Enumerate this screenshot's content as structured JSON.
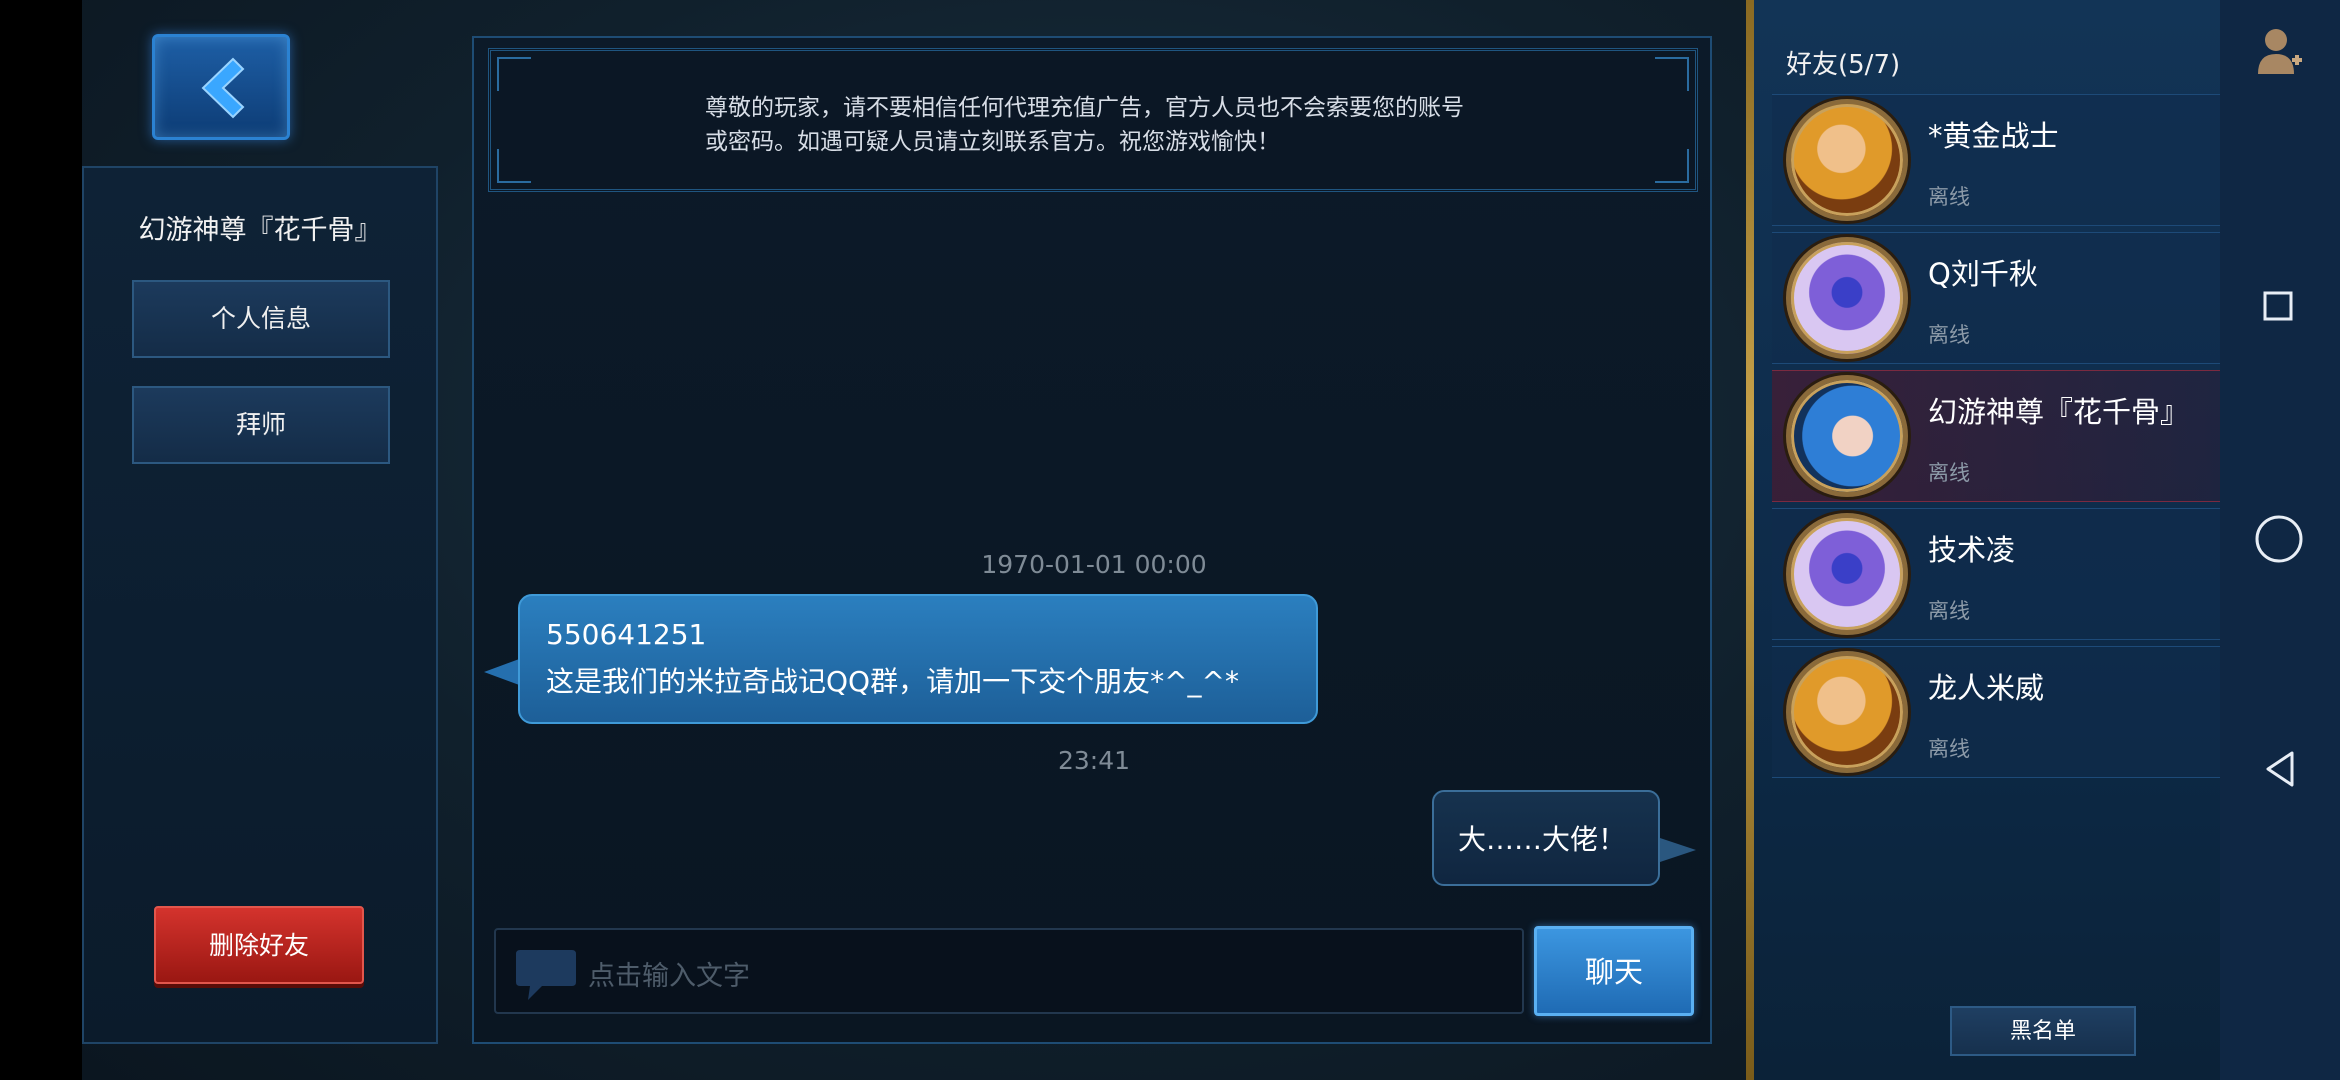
{
  "header": {
    "back_icon": "chevron-left-icon"
  },
  "profile": {
    "name": "幻游神尊『花千骨』",
    "personal_info_label": "个人信息",
    "mentor_label": "拜师",
    "delete_label": "删除好友"
  },
  "chat": {
    "notice_line1": "尊敬的玩家，请不要相信任何代理充值广告，官方人员也不会索要您的账号",
    "notice_line2": "或密码。如遇可疑人员请立刻联系官方。祝您游戏愉快！",
    "messages": [
      {
        "timestamp": "1970-01-01 00:00",
        "direction": "incoming",
        "line1": "550641251",
        "line2": "这是我们的米拉奇战记QQ群，请加一下交个朋友*^_^*"
      },
      {
        "timestamp": "23:41",
        "direction": "outgoing",
        "line1": "大……大佬！"
      }
    ],
    "input_placeholder": "点击输入文字",
    "send_label": "聊天"
  },
  "friends": {
    "header": "好友(5/7)",
    "list": [
      {
        "name": "*黄金战士",
        "status": "离线",
        "avatar": "blonde-warrior",
        "selected": false
      },
      {
        "name": "Q刘千秋",
        "status": "离线",
        "avatar": "crystal",
        "selected": false
      },
      {
        "name": "幻游神尊『花千骨』",
        "status": "离线",
        "avatar": "blue-hair-girl",
        "selected": true
      },
      {
        "name": "技术凌",
        "status": "离线",
        "avatar": "crystal",
        "selected": false
      },
      {
        "name": "龙人米威",
        "status": "离线",
        "avatar": "blonde-warrior",
        "selected": false
      }
    ],
    "blacklist_label": "黑名单"
  },
  "colors": {
    "accent": "#2b82d2",
    "danger": "#c12a24",
    "gold": "#c7a24a"
  }
}
